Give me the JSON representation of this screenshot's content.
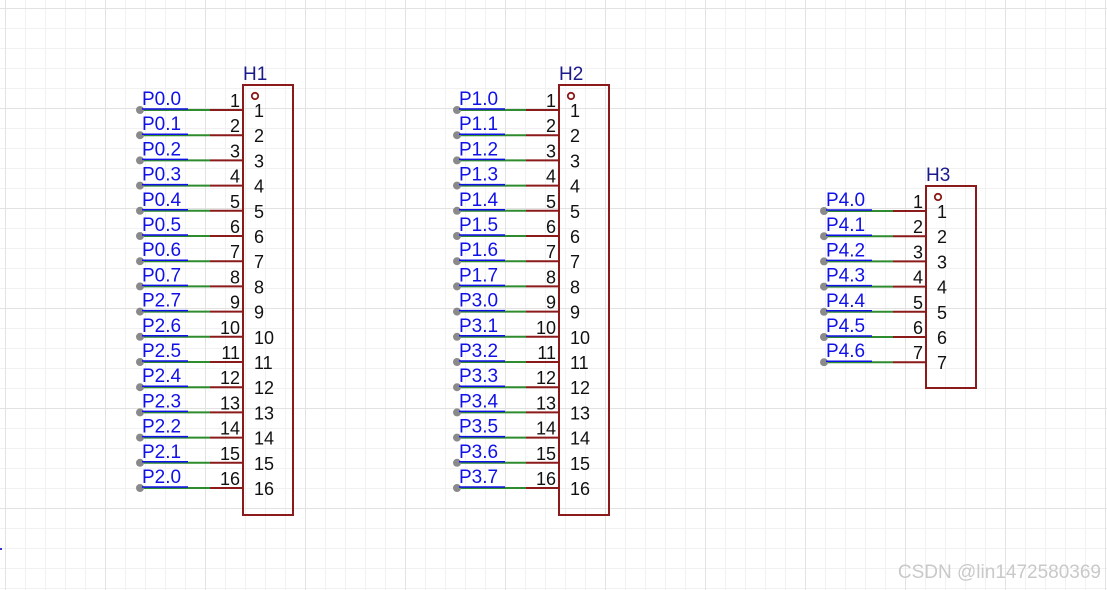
{
  "diagram": {
    "headers": [
      {
        "ref": "H1",
        "pins": [
          {
            "num": "1",
            "name": "1",
            "net": "P0.0"
          },
          {
            "num": "2",
            "name": "2",
            "net": "P0.1"
          },
          {
            "num": "3",
            "name": "3",
            "net": "P0.2"
          },
          {
            "num": "4",
            "name": "4",
            "net": "P0.3"
          },
          {
            "num": "5",
            "name": "5",
            "net": "P0.4"
          },
          {
            "num": "6",
            "name": "6",
            "net": "P0.5"
          },
          {
            "num": "7",
            "name": "7",
            "net": "P0.6"
          },
          {
            "num": "8",
            "name": "8",
            "net": "P0.7"
          },
          {
            "num": "9",
            "name": "9",
            "net": "P2.7"
          },
          {
            "num": "10",
            "name": "10",
            "net": "P2.6"
          },
          {
            "num": "11",
            "name": "11",
            "net": "P2.5"
          },
          {
            "num": "12",
            "name": "12",
            "net": "P2.4"
          },
          {
            "num": "13",
            "name": "13",
            "net": "P2.3"
          },
          {
            "num": "14",
            "name": "14",
            "net": "P2.2"
          },
          {
            "num": "15",
            "name": "15",
            "net": "P2.1"
          },
          {
            "num": "16",
            "name": "16",
            "net": "P2.0"
          }
        ]
      },
      {
        "ref": "H2",
        "pins": [
          {
            "num": "1",
            "name": "1",
            "net": "P1.0"
          },
          {
            "num": "2",
            "name": "2",
            "net": "P1.1"
          },
          {
            "num": "3",
            "name": "3",
            "net": "P1.2"
          },
          {
            "num": "4",
            "name": "4",
            "net": "P1.3"
          },
          {
            "num": "5",
            "name": "5",
            "net": "P1.4"
          },
          {
            "num": "6",
            "name": "6",
            "net": "P1.5"
          },
          {
            "num": "7",
            "name": "7",
            "net": "P1.6"
          },
          {
            "num": "8",
            "name": "8",
            "net": "P1.7"
          },
          {
            "num": "9",
            "name": "9",
            "net": "P3.0"
          },
          {
            "num": "10",
            "name": "10",
            "net": "P3.1"
          },
          {
            "num": "11",
            "name": "11",
            "net": "P3.2"
          },
          {
            "num": "12",
            "name": "12",
            "net": "P3.3"
          },
          {
            "num": "13",
            "name": "13",
            "net": "P3.4"
          },
          {
            "num": "14",
            "name": "14",
            "net": "P3.5"
          },
          {
            "num": "15",
            "name": "15",
            "net": "P3.6"
          },
          {
            "num": "16",
            "name": "16",
            "net": "P3.7"
          }
        ]
      },
      {
        "ref": "H3",
        "pins": [
          {
            "num": "1",
            "name": "1",
            "net": "P4.0"
          },
          {
            "num": "2",
            "name": "2",
            "net": "P4.1"
          },
          {
            "num": "3",
            "name": "3",
            "net": "P4.2"
          },
          {
            "num": "4",
            "name": "4",
            "net": "P4.3"
          },
          {
            "num": "5",
            "name": "5",
            "net": "P4.4"
          },
          {
            "num": "6",
            "name": "6",
            "net": "P4.5"
          },
          {
            "num": "7",
            "name": "7",
            "net": "P4.6"
          }
        ]
      }
    ],
    "colors": {
      "net_label": "#1010e8",
      "wire": "#2e8b2e",
      "pin_line": "#8b1a1a",
      "body": "#8b1a1a",
      "text": "#111111",
      "ref": "#1a1a8b",
      "terminal": "#8a8a8a"
    }
  },
  "watermark": "CSDN @lin1472580369"
}
